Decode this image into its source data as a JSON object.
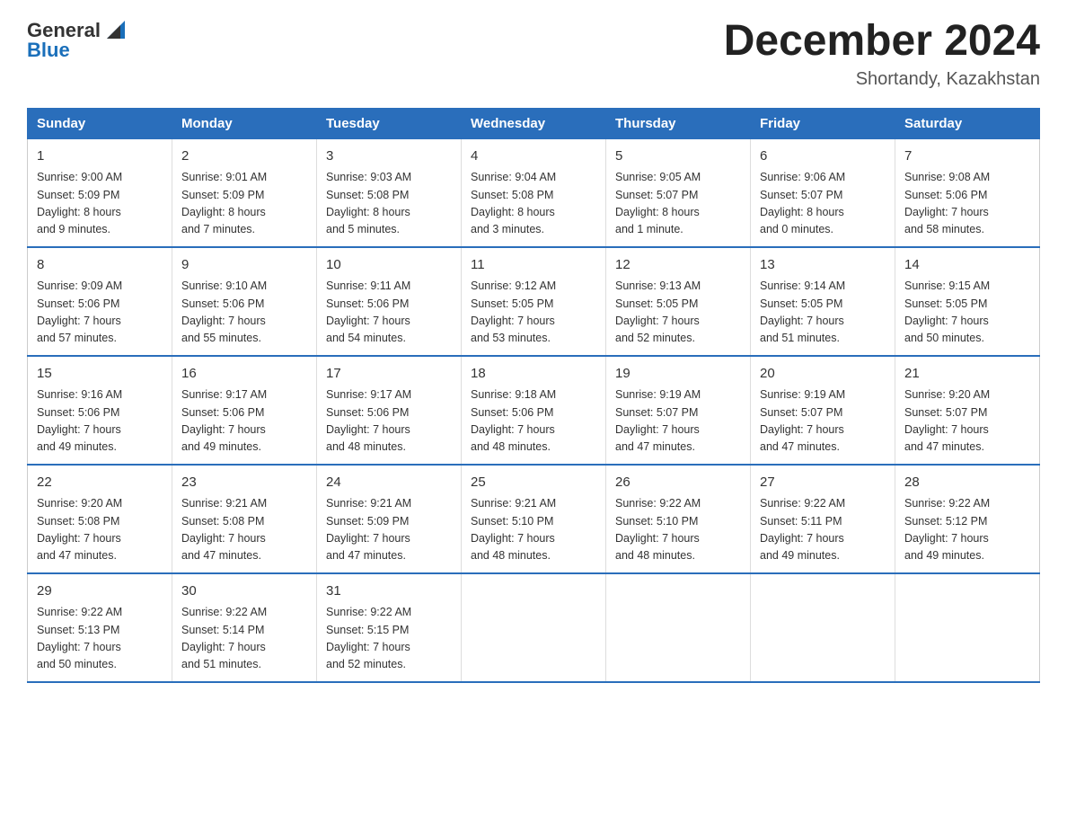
{
  "header": {
    "logo_general": "General",
    "logo_blue": "Blue",
    "month_title": "December 2024",
    "location": "Shortandy, Kazakhstan"
  },
  "weekdays": [
    "Sunday",
    "Monday",
    "Tuesday",
    "Wednesday",
    "Thursday",
    "Friday",
    "Saturday"
  ],
  "weeks": [
    [
      {
        "day": "1",
        "sunrise": "9:00 AM",
        "sunset": "5:09 PM",
        "daylight": "8 hours and 9 minutes."
      },
      {
        "day": "2",
        "sunrise": "9:01 AM",
        "sunset": "5:09 PM",
        "daylight": "8 hours and 7 minutes."
      },
      {
        "day": "3",
        "sunrise": "9:03 AM",
        "sunset": "5:08 PM",
        "daylight": "8 hours and 5 minutes."
      },
      {
        "day": "4",
        "sunrise": "9:04 AM",
        "sunset": "5:08 PM",
        "daylight": "8 hours and 3 minutes."
      },
      {
        "day": "5",
        "sunrise": "9:05 AM",
        "sunset": "5:07 PM",
        "daylight": "8 hours and 1 minute."
      },
      {
        "day": "6",
        "sunrise": "9:06 AM",
        "sunset": "5:07 PM",
        "daylight": "8 hours and 0 minutes."
      },
      {
        "day": "7",
        "sunrise": "9:08 AM",
        "sunset": "5:06 PM",
        "daylight": "7 hours and 58 minutes."
      }
    ],
    [
      {
        "day": "8",
        "sunrise": "9:09 AM",
        "sunset": "5:06 PM",
        "daylight": "7 hours and 57 minutes."
      },
      {
        "day": "9",
        "sunrise": "9:10 AM",
        "sunset": "5:06 PM",
        "daylight": "7 hours and 55 minutes."
      },
      {
        "day": "10",
        "sunrise": "9:11 AM",
        "sunset": "5:06 PM",
        "daylight": "7 hours and 54 minutes."
      },
      {
        "day": "11",
        "sunrise": "9:12 AM",
        "sunset": "5:05 PM",
        "daylight": "7 hours and 53 minutes."
      },
      {
        "day": "12",
        "sunrise": "9:13 AM",
        "sunset": "5:05 PM",
        "daylight": "7 hours and 52 minutes."
      },
      {
        "day": "13",
        "sunrise": "9:14 AM",
        "sunset": "5:05 PM",
        "daylight": "7 hours and 51 minutes."
      },
      {
        "day": "14",
        "sunrise": "9:15 AM",
        "sunset": "5:05 PM",
        "daylight": "7 hours and 50 minutes."
      }
    ],
    [
      {
        "day": "15",
        "sunrise": "9:16 AM",
        "sunset": "5:06 PM",
        "daylight": "7 hours and 49 minutes."
      },
      {
        "day": "16",
        "sunrise": "9:17 AM",
        "sunset": "5:06 PM",
        "daylight": "7 hours and 49 minutes."
      },
      {
        "day": "17",
        "sunrise": "9:17 AM",
        "sunset": "5:06 PM",
        "daylight": "7 hours and 48 minutes."
      },
      {
        "day": "18",
        "sunrise": "9:18 AM",
        "sunset": "5:06 PM",
        "daylight": "7 hours and 48 minutes."
      },
      {
        "day": "19",
        "sunrise": "9:19 AM",
        "sunset": "5:07 PM",
        "daylight": "7 hours and 47 minutes."
      },
      {
        "day": "20",
        "sunrise": "9:19 AM",
        "sunset": "5:07 PM",
        "daylight": "7 hours and 47 minutes."
      },
      {
        "day": "21",
        "sunrise": "9:20 AM",
        "sunset": "5:07 PM",
        "daylight": "7 hours and 47 minutes."
      }
    ],
    [
      {
        "day": "22",
        "sunrise": "9:20 AM",
        "sunset": "5:08 PM",
        "daylight": "7 hours and 47 minutes."
      },
      {
        "day": "23",
        "sunrise": "9:21 AM",
        "sunset": "5:08 PM",
        "daylight": "7 hours and 47 minutes."
      },
      {
        "day": "24",
        "sunrise": "9:21 AM",
        "sunset": "5:09 PM",
        "daylight": "7 hours and 47 minutes."
      },
      {
        "day": "25",
        "sunrise": "9:21 AM",
        "sunset": "5:10 PM",
        "daylight": "7 hours and 48 minutes."
      },
      {
        "day": "26",
        "sunrise": "9:22 AM",
        "sunset": "5:10 PM",
        "daylight": "7 hours and 48 minutes."
      },
      {
        "day": "27",
        "sunrise": "9:22 AM",
        "sunset": "5:11 PM",
        "daylight": "7 hours and 49 minutes."
      },
      {
        "day": "28",
        "sunrise": "9:22 AM",
        "sunset": "5:12 PM",
        "daylight": "7 hours and 49 minutes."
      }
    ],
    [
      {
        "day": "29",
        "sunrise": "9:22 AM",
        "sunset": "5:13 PM",
        "daylight": "7 hours and 50 minutes."
      },
      {
        "day": "30",
        "sunrise": "9:22 AM",
        "sunset": "5:14 PM",
        "daylight": "7 hours and 51 minutes."
      },
      {
        "day": "31",
        "sunrise": "9:22 AM",
        "sunset": "5:15 PM",
        "daylight": "7 hours and 52 minutes."
      },
      null,
      null,
      null,
      null
    ]
  ],
  "labels": {
    "sunrise": "Sunrise:",
    "sunset": "Sunset:",
    "daylight": "Daylight:"
  }
}
